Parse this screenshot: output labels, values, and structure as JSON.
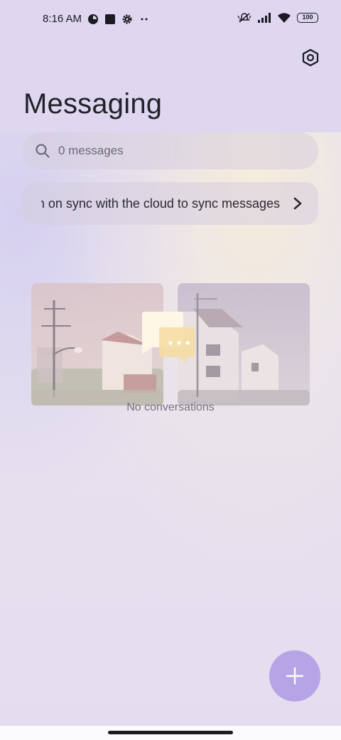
{
  "status_bar": {
    "time": "8:16 AM",
    "battery": "100",
    "icons": [
      "notification-dot-icon",
      "app-square-icon",
      "settings-gear-icon",
      "more-dots-icon",
      "silent-mode-icon",
      "signal-icon",
      "wifi-icon",
      "battery-icon"
    ]
  },
  "header": {
    "title": "Messaging",
    "settings_icon": "hexagon-settings-icon"
  },
  "search": {
    "placeholder": "0 messages",
    "icon": "search-icon"
  },
  "sync_banner": {
    "text": "Turn on sync with the cloud to sync messages",
    "icon": "chevron-right-icon"
  },
  "empty_state": {
    "label": "No conversations",
    "icon": "chat-bubbles-icon"
  },
  "fab": {
    "icon": "plus-icon"
  },
  "colors": {
    "header_bg": "#dfd7ef",
    "fab": "#b6a4e6",
    "background": "#e6dff0"
  }
}
